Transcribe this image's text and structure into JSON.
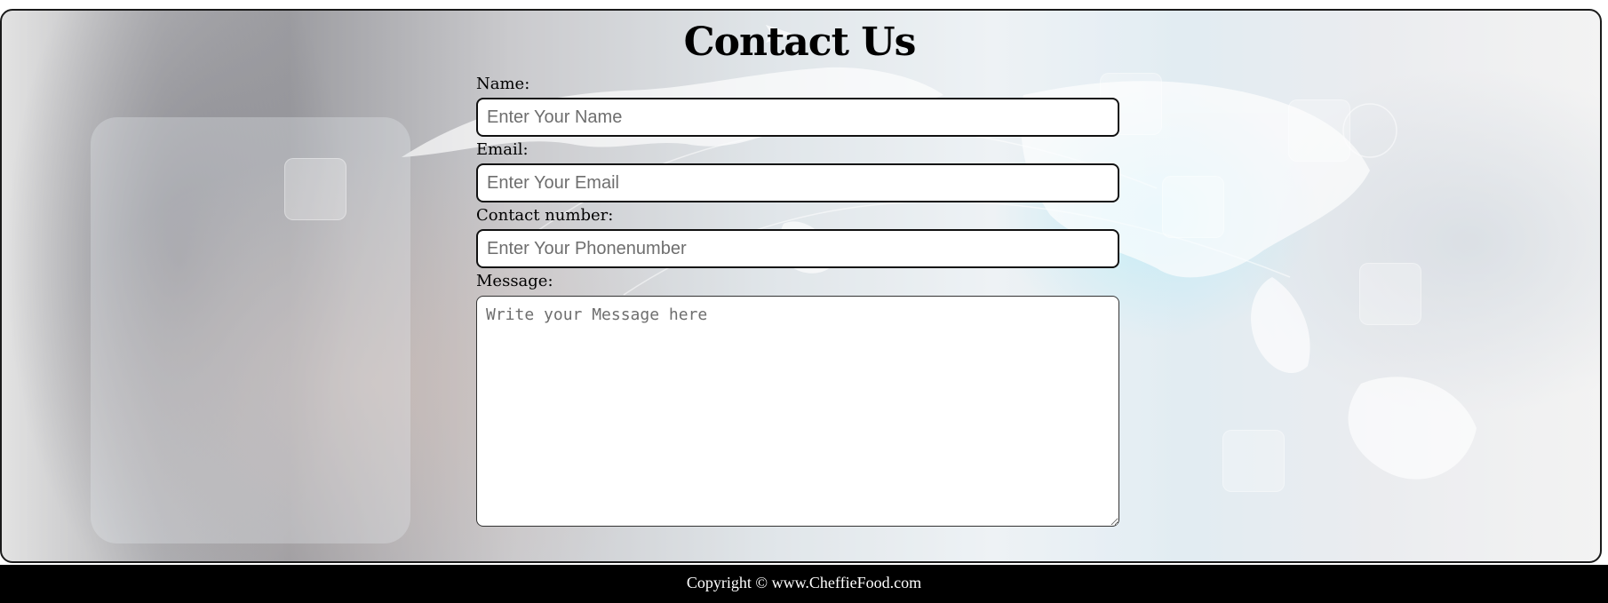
{
  "page": {
    "title": "Contact Us"
  },
  "form": {
    "name": {
      "label": "Name:",
      "placeholder": "Enter Your Name",
      "value": ""
    },
    "email": {
      "label": "Email:",
      "placeholder": "Enter Your Email",
      "value": ""
    },
    "contact_number": {
      "label": "Contact number:",
      "placeholder": "Enter Your Phonenumber",
      "value": ""
    },
    "message": {
      "label": "Message:",
      "placeholder": "Write your Message here",
      "value": ""
    }
  },
  "footer": {
    "copyright": "Copyright © www.CheffieFood.com"
  },
  "colors": {
    "footer_background": "#000000",
    "footer_text": "#ffffff",
    "field_border": "#111111",
    "title_text": "#000000"
  }
}
